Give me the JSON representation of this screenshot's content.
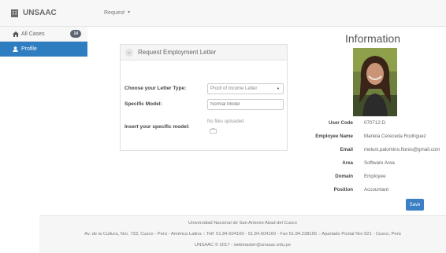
{
  "navbar": {
    "brand": "UNSAAC",
    "request_menu": "Request"
  },
  "sidebar": {
    "items": [
      {
        "label": "All Cases",
        "badge": "14"
      },
      {
        "label": "Profile"
      }
    ]
  },
  "panel": {
    "title": "Request Employment Letter",
    "letter_type_label": "Choose your Letter Type:",
    "letter_type_value": "Proof of Income Letter",
    "specific_model_label": "Specific Model:",
    "specific_model_placeholder": "Normal Model",
    "insert_model_label": "Insert your specific model:",
    "no_files": "No files uploaded"
  },
  "information": {
    "title": "Information",
    "fields": [
      {
        "label": "User Code",
        "value": "070712-D"
      },
      {
        "label": "Employee Name",
        "value": "Mariela Cereceda Rodriguez"
      },
      {
        "label": "Email",
        "value": "meluni.palomino.flores@gmail.com"
      },
      {
        "label": "Area",
        "value": "Software Area"
      },
      {
        "label": "Domain",
        "value": "Employee"
      },
      {
        "label": "Position",
        "value": "Accountant"
      }
    ],
    "save_label": "Save"
  },
  "footer": {
    "line1": "Universidad Nacional de San Antonio Abad del Cusco",
    "line2": "Av. de la Cultura, Nro. 733, Cusco - Perú - América Latina :: Telf: 51.84.604100 - 51.84.604160 - Fax 51.84.238156 :: Apartado Postal Nro 921 - Cusco, Perú",
    "line3": "UNSAAC © 2017 - webmaster@unsaac.edu.pe"
  },
  "colors": {
    "accent": "#2f7dc1",
    "save_button": "#3b80c4",
    "badge": "#5b6670"
  }
}
